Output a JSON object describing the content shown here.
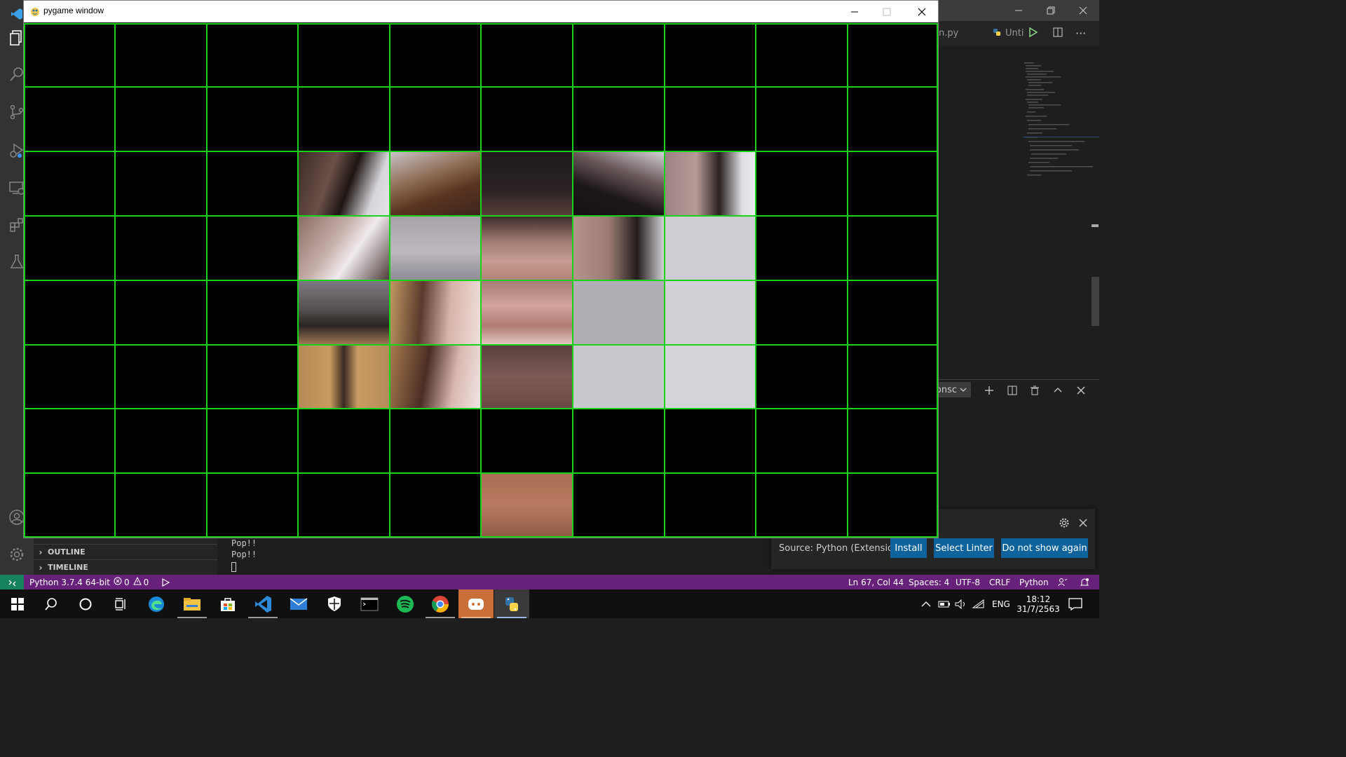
{
  "pygame_window": {
    "title": "pygame window",
    "grid": {
      "columns": 10,
      "rows": 8,
      "line_color": "#1bd21b"
    }
  },
  "vscode": {
    "editor_tabs": [
      {
        "label": "n.py"
      },
      {
        "label": "Unti"
      }
    ],
    "panel": {
      "terminal_select": "onsc"
    },
    "sidebar": {
      "explorer_header": "",
      "sections": [
        {
          "label": "OUTLINE"
        },
        {
          "label": "TIMELINE"
        }
      ]
    },
    "terminal": {
      "lines": [
        "Pop!!",
        "Pop!!"
      ]
    },
    "notification": {
      "source": "Source: Python (Extension)",
      "buttons": [
        {
          "label": "Install"
        },
        {
          "label": "Select Linter"
        },
        {
          "label": "Do not show again"
        }
      ]
    },
    "statusbar": {
      "interpreter": "Python 3.7.4 64-bit",
      "errors": "0",
      "warnings": "0",
      "position": "Ln 67, Col 44",
      "spaces": "Spaces: 4",
      "encoding": "UTF-8",
      "eol": "CRLF",
      "language": "Python",
      "accent": "#68217a"
    }
  },
  "taskbar": {
    "language": "ENG",
    "time": "18:12",
    "date": "31/7/2563"
  }
}
